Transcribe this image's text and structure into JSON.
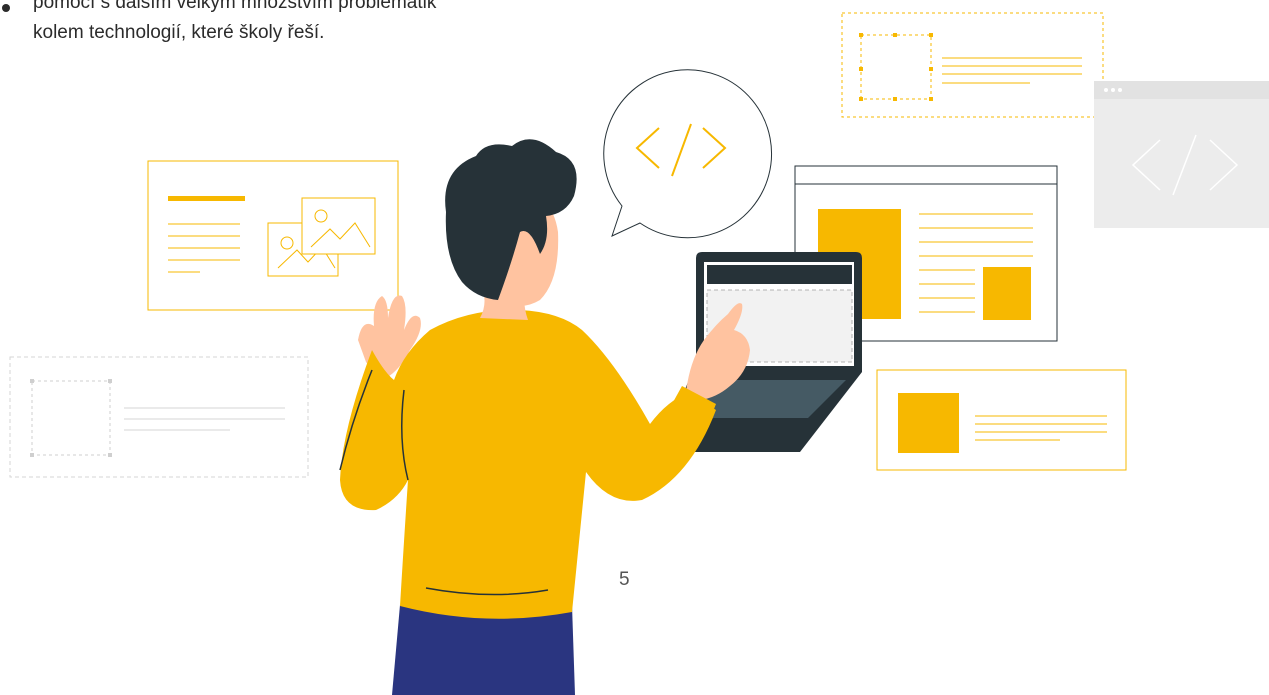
{
  "slide": {
    "text_lines": [
      "pomocí s dalším velkým množstvím problematik",
      "kolem technologií, které školy řeší."
    ],
    "page_number": "5"
  },
  "illustration": {
    "code_symbol": "</>",
    "accent_color": "#F7B800",
    "dark_color": "#263238",
    "pants_color": "#2A3580"
  }
}
